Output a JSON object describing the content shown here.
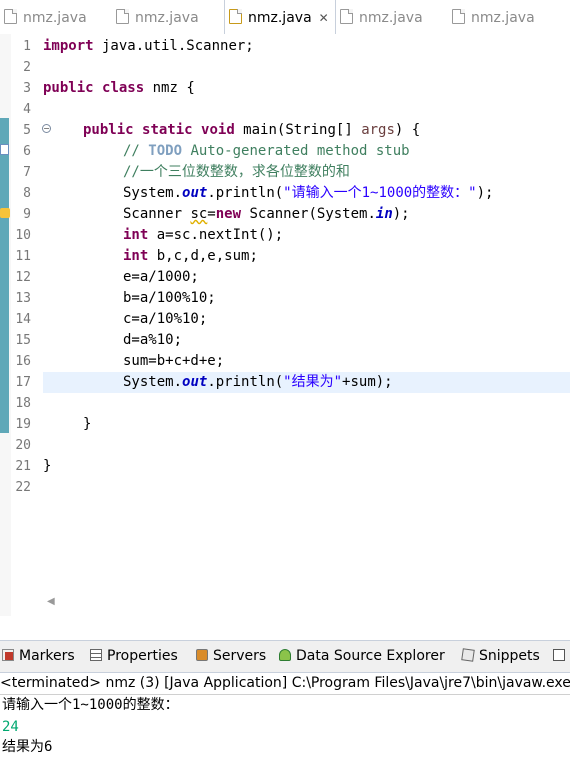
{
  "editor_tabs": [
    {
      "label": "nmz.java",
      "active": false,
      "dirty": false,
      "icon": "java-file-icon"
    },
    {
      "label": "nmz.java",
      "active": false,
      "dirty": false,
      "icon": "java-file-icon"
    },
    {
      "label": "nmz.java",
      "active": true,
      "dirty": false,
      "icon": "java-file-icon"
    },
    {
      "label": "nmz.java",
      "active": false,
      "dirty": false,
      "icon": "java-file-icon"
    },
    {
      "label": "nmz.java",
      "active": false,
      "dirty": false,
      "icon": "java-file-icon"
    }
  ],
  "code": {
    "line_numbers": [
      "1",
      "2",
      "3",
      "4",
      "5",
      "6",
      "7",
      "8",
      "9",
      "10",
      "11",
      "12",
      "13",
      "14",
      "15",
      "16",
      "17",
      "18",
      "19",
      "20",
      "21",
      "22"
    ],
    "current_line": 17,
    "lines": [
      {
        "n": 1,
        "indent": 0,
        "tokens": [
          {
            "t": "import",
            "c": "kw"
          },
          {
            "t": " java.util.Scanner;",
            "c": ""
          }
        ]
      },
      {
        "n": 2,
        "indent": 0,
        "tokens": []
      },
      {
        "n": 3,
        "indent": 0,
        "tokens": [
          {
            "t": "public",
            "c": "kw"
          },
          {
            "t": " ",
            "c": ""
          },
          {
            "t": "class",
            "c": "kw"
          },
          {
            "t": " nmz {",
            "c": ""
          }
        ]
      },
      {
        "n": 4,
        "indent": 0,
        "tokens": []
      },
      {
        "n": 5,
        "indent": 1,
        "tokens": [
          {
            "t": "public",
            "c": "kw"
          },
          {
            "t": " ",
            "c": ""
          },
          {
            "t": "static",
            "c": "kw"
          },
          {
            "t": " ",
            "c": ""
          },
          {
            "t": "void",
            "c": "kw"
          },
          {
            "t": " main(String[] ",
            "c": ""
          },
          {
            "t": "args",
            "c": "vr"
          },
          {
            "t": ") {",
            "c": ""
          }
        ]
      },
      {
        "n": 6,
        "indent": 2,
        "tokens": [
          {
            "t": "// ",
            "c": "cm"
          },
          {
            "t": "TODO",
            "c": "todo"
          },
          {
            "t": " Auto-generated method stub",
            "c": "cm"
          }
        ]
      },
      {
        "n": 7,
        "indent": 2,
        "tokens": [
          {
            "t": "//一个三位数整数，求各位整数的和",
            "c": "cm"
          }
        ]
      },
      {
        "n": 8,
        "indent": 2,
        "tokens": [
          {
            "t": "System.",
            "c": ""
          },
          {
            "t": "out",
            "c": "fld"
          },
          {
            "t": ".println(",
            "c": ""
          },
          {
            "t": "\"请输入一个1~1000的整数：\"",
            "c": "str"
          },
          {
            "t": ");",
            "c": ""
          }
        ]
      },
      {
        "n": 9,
        "indent": 2,
        "tokens": [
          {
            "t": "Scanner ",
            "c": ""
          },
          {
            "t": "sc",
            "c": "sq"
          },
          {
            "t": "=",
            "c": ""
          },
          {
            "t": "new",
            "c": "kw"
          },
          {
            "t": " Scanner(System.",
            "c": ""
          },
          {
            "t": "in",
            "c": "fld"
          },
          {
            "t": ");",
            "c": ""
          }
        ]
      },
      {
        "n": 10,
        "indent": 2,
        "tokens": [
          {
            "t": "int",
            "c": "kw"
          },
          {
            "t": " a=sc.nextInt();",
            "c": ""
          }
        ]
      },
      {
        "n": 11,
        "indent": 2,
        "tokens": [
          {
            "t": "int",
            "c": "kw"
          },
          {
            "t": " b,c,d,e,sum;",
            "c": ""
          }
        ]
      },
      {
        "n": 12,
        "indent": 2,
        "tokens": [
          {
            "t": "e=a/1000;",
            "c": ""
          }
        ]
      },
      {
        "n": 13,
        "indent": 2,
        "tokens": [
          {
            "t": "b=a/100%10;",
            "c": ""
          }
        ]
      },
      {
        "n": 14,
        "indent": 2,
        "tokens": [
          {
            "t": "c=a/10%10;",
            "c": ""
          }
        ]
      },
      {
        "n": 15,
        "indent": 2,
        "tokens": [
          {
            "t": "d=a%10;",
            "c": ""
          }
        ]
      },
      {
        "n": 16,
        "indent": 2,
        "tokens": [
          {
            "t": "sum=b+c+d+e;",
            "c": ""
          }
        ]
      },
      {
        "n": 17,
        "indent": 2,
        "tokens": [
          {
            "t": "System.",
            "c": ""
          },
          {
            "t": "out",
            "c": "fld"
          },
          {
            "t": ".println(",
            "c": ""
          },
          {
            "t": "\"结果为\"",
            "c": "str"
          },
          {
            "t": "+sum);",
            "c": ""
          }
        ]
      },
      {
        "n": 18,
        "indent": 0,
        "tokens": []
      },
      {
        "n": 19,
        "indent": 1,
        "tokens": [
          {
            "t": "}",
            "c": ""
          }
        ]
      },
      {
        "n": 20,
        "indent": 0,
        "tokens": []
      },
      {
        "n": 21,
        "indent": 0,
        "tokens": [
          {
            "t": "}",
            "c": ""
          }
        ]
      },
      {
        "n": 22,
        "indent": 0,
        "tokens": []
      }
    ]
  },
  "views": [
    {
      "label": "Markers",
      "icon": "markers-icon"
    },
    {
      "label": "Properties",
      "icon": "properties-icon"
    },
    {
      "label": "Servers",
      "icon": "servers-icon"
    },
    {
      "label": "Data Source Explorer",
      "icon": "data-source-icon"
    },
    {
      "label": "Snippets",
      "icon": "snippets-icon"
    },
    {
      "label": "",
      "icon": "console-icon"
    }
  ],
  "console": {
    "header": "<terminated> nmz (3) [Java Application] C:\\Program Files\\Java\\jre7\\bin\\javaw.exe",
    "lines": [
      {
        "text": "请输入一个1~1000的整数：",
        "type": "out"
      },
      {
        "text": "24",
        "type": "in"
      },
      {
        "text": "结果为6",
        "type": "out"
      }
    ]
  },
  "colors": {
    "keyword": "#7f0055",
    "comment": "#3f7f5f",
    "string": "#2a00ff",
    "field": "#0000c0",
    "console_input": "#00a870",
    "current_line": "#e8f2fe",
    "change_bar": "#5fa8b8"
  }
}
